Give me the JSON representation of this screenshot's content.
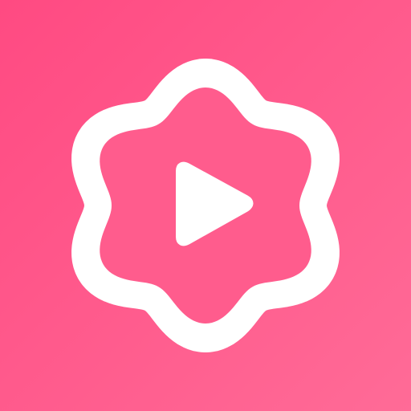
{
  "app_icon": {
    "icon": "play-flower-icon",
    "colors": {
      "background_start": "#ff4a82",
      "background_end": "#ff6b97",
      "ring": "#ffffff",
      "inner": "#ff5c8d",
      "play": "#ffffff"
    }
  }
}
